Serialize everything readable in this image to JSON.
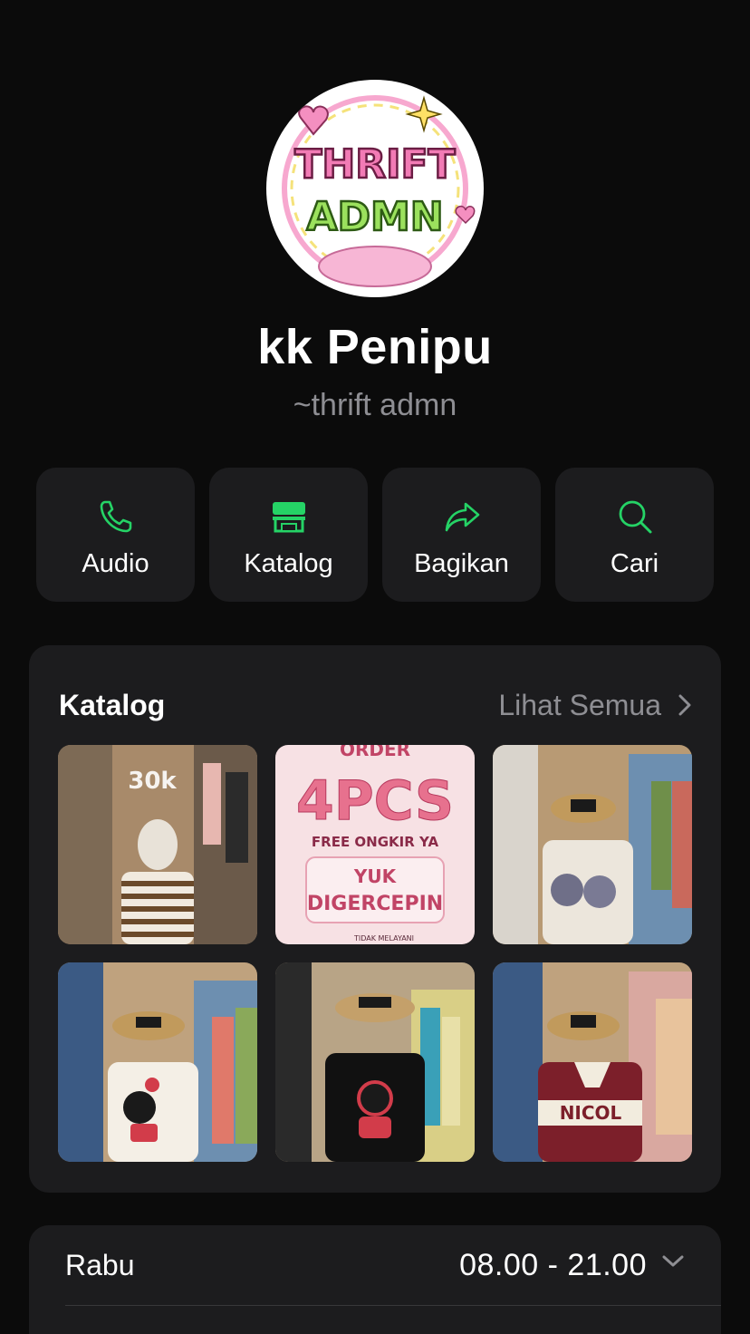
{
  "profile": {
    "name": "kk Penipu",
    "subtitle": "~thrift admn",
    "avatar_logo_text": [
      "THRIFT",
      "ADMN"
    ]
  },
  "actions": [
    {
      "label": "Audio",
      "icon": "phone-icon"
    },
    {
      "label": "Katalog",
      "icon": "store-icon"
    },
    {
      "label": "Bagikan",
      "icon": "share-icon"
    },
    {
      "label": "Cari",
      "icon": "search-icon"
    }
  ],
  "catalog": {
    "title": "Katalog",
    "see_all": "Lihat Semua",
    "thumb_texts": {
      "price_tag": "30k",
      "promo_line1": "ORDER",
      "promo_line2": "4PCS",
      "promo_line3": "FREE ONGKIR YA",
      "promo_line4": "YUK",
      "promo_line5": "DIGERCEPIN",
      "promo_line6": "TIDAK MELAYANI",
      "shirt_text": "NICOL"
    }
  },
  "hours": {
    "day": "Rabu",
    "time": "08.00 - 21.00"
  },
  "colors": {
    "accent": "#25d366",
    "background": "#0b0b0b",
    "card": "#1c1c1e",
    "muted": "#8e8e93"
  }
}
